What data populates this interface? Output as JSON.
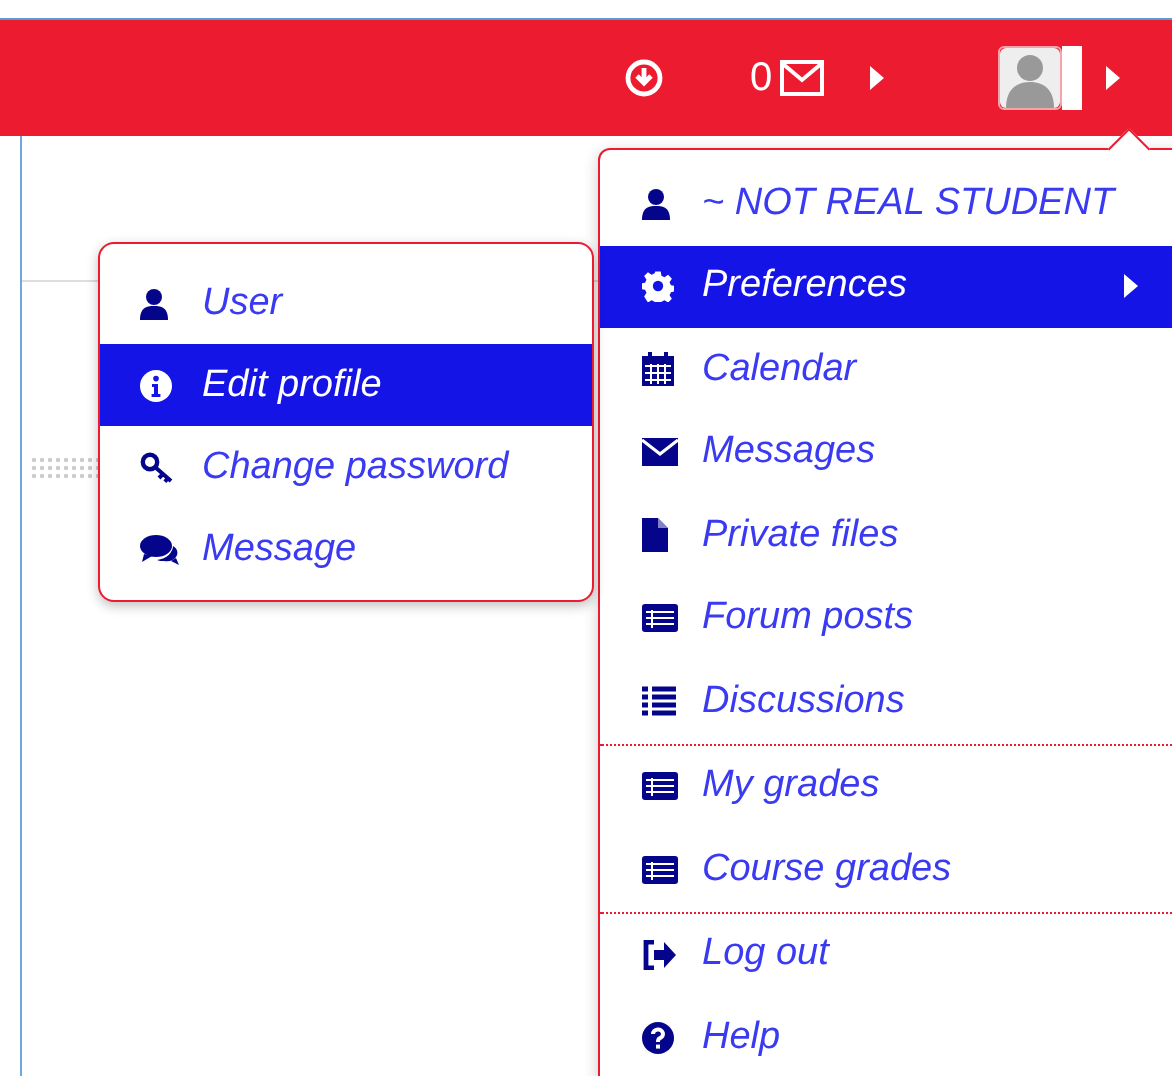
{
  "header": {
    "message_count": "0"
  },
  "user_menu": {
    "groups": [
      [
        {
          "label": "~ NOT REAL STUDENT",
          "selected": false,
          "submenu": false
        },
        {
          "label": "Preferences",
          "selected": true,
          "submenu": true
        },
        {
          "label": "Calendar",
          "selected": false,
          "submenu": false
        },
        {
          "label": "Messages",
          "selected": false,
          "submenu": false
        },
        {
          "label": "Private files",
          "selected": false,
          "submenu": false
        },
        {
          "label": "Forum posts",
          "selected": false,
          "submenu": false
        },
        {
          "label": "Discussions",
          "selected": false,
          "submenu": false
        }
      ],
      [
        {
          "label": "My grades",
          "selected": false,
          "submenu": false
        },
        {
          "label": "Course grades",
          "selected": false,
          "submenu": false
        }
      ],
      [
        {
          "label": "Log out",
          "selected": false,
          "submenu": false
        },
        {
          "label": "Help",
          "selected": false,
          "submenu": false
        }
      ]
    ]
  },
  "preferences_menu": {
    "items": [
      {
        "label": "User",
        "selected": false
      },
      {
        "label": "Edit profile",
        "selected": true
      },
      {
        "label": "Change password",
        "selected": false
      },
      {
        "label": "Message",
        "selected": false
      }
    ]
  }
}
